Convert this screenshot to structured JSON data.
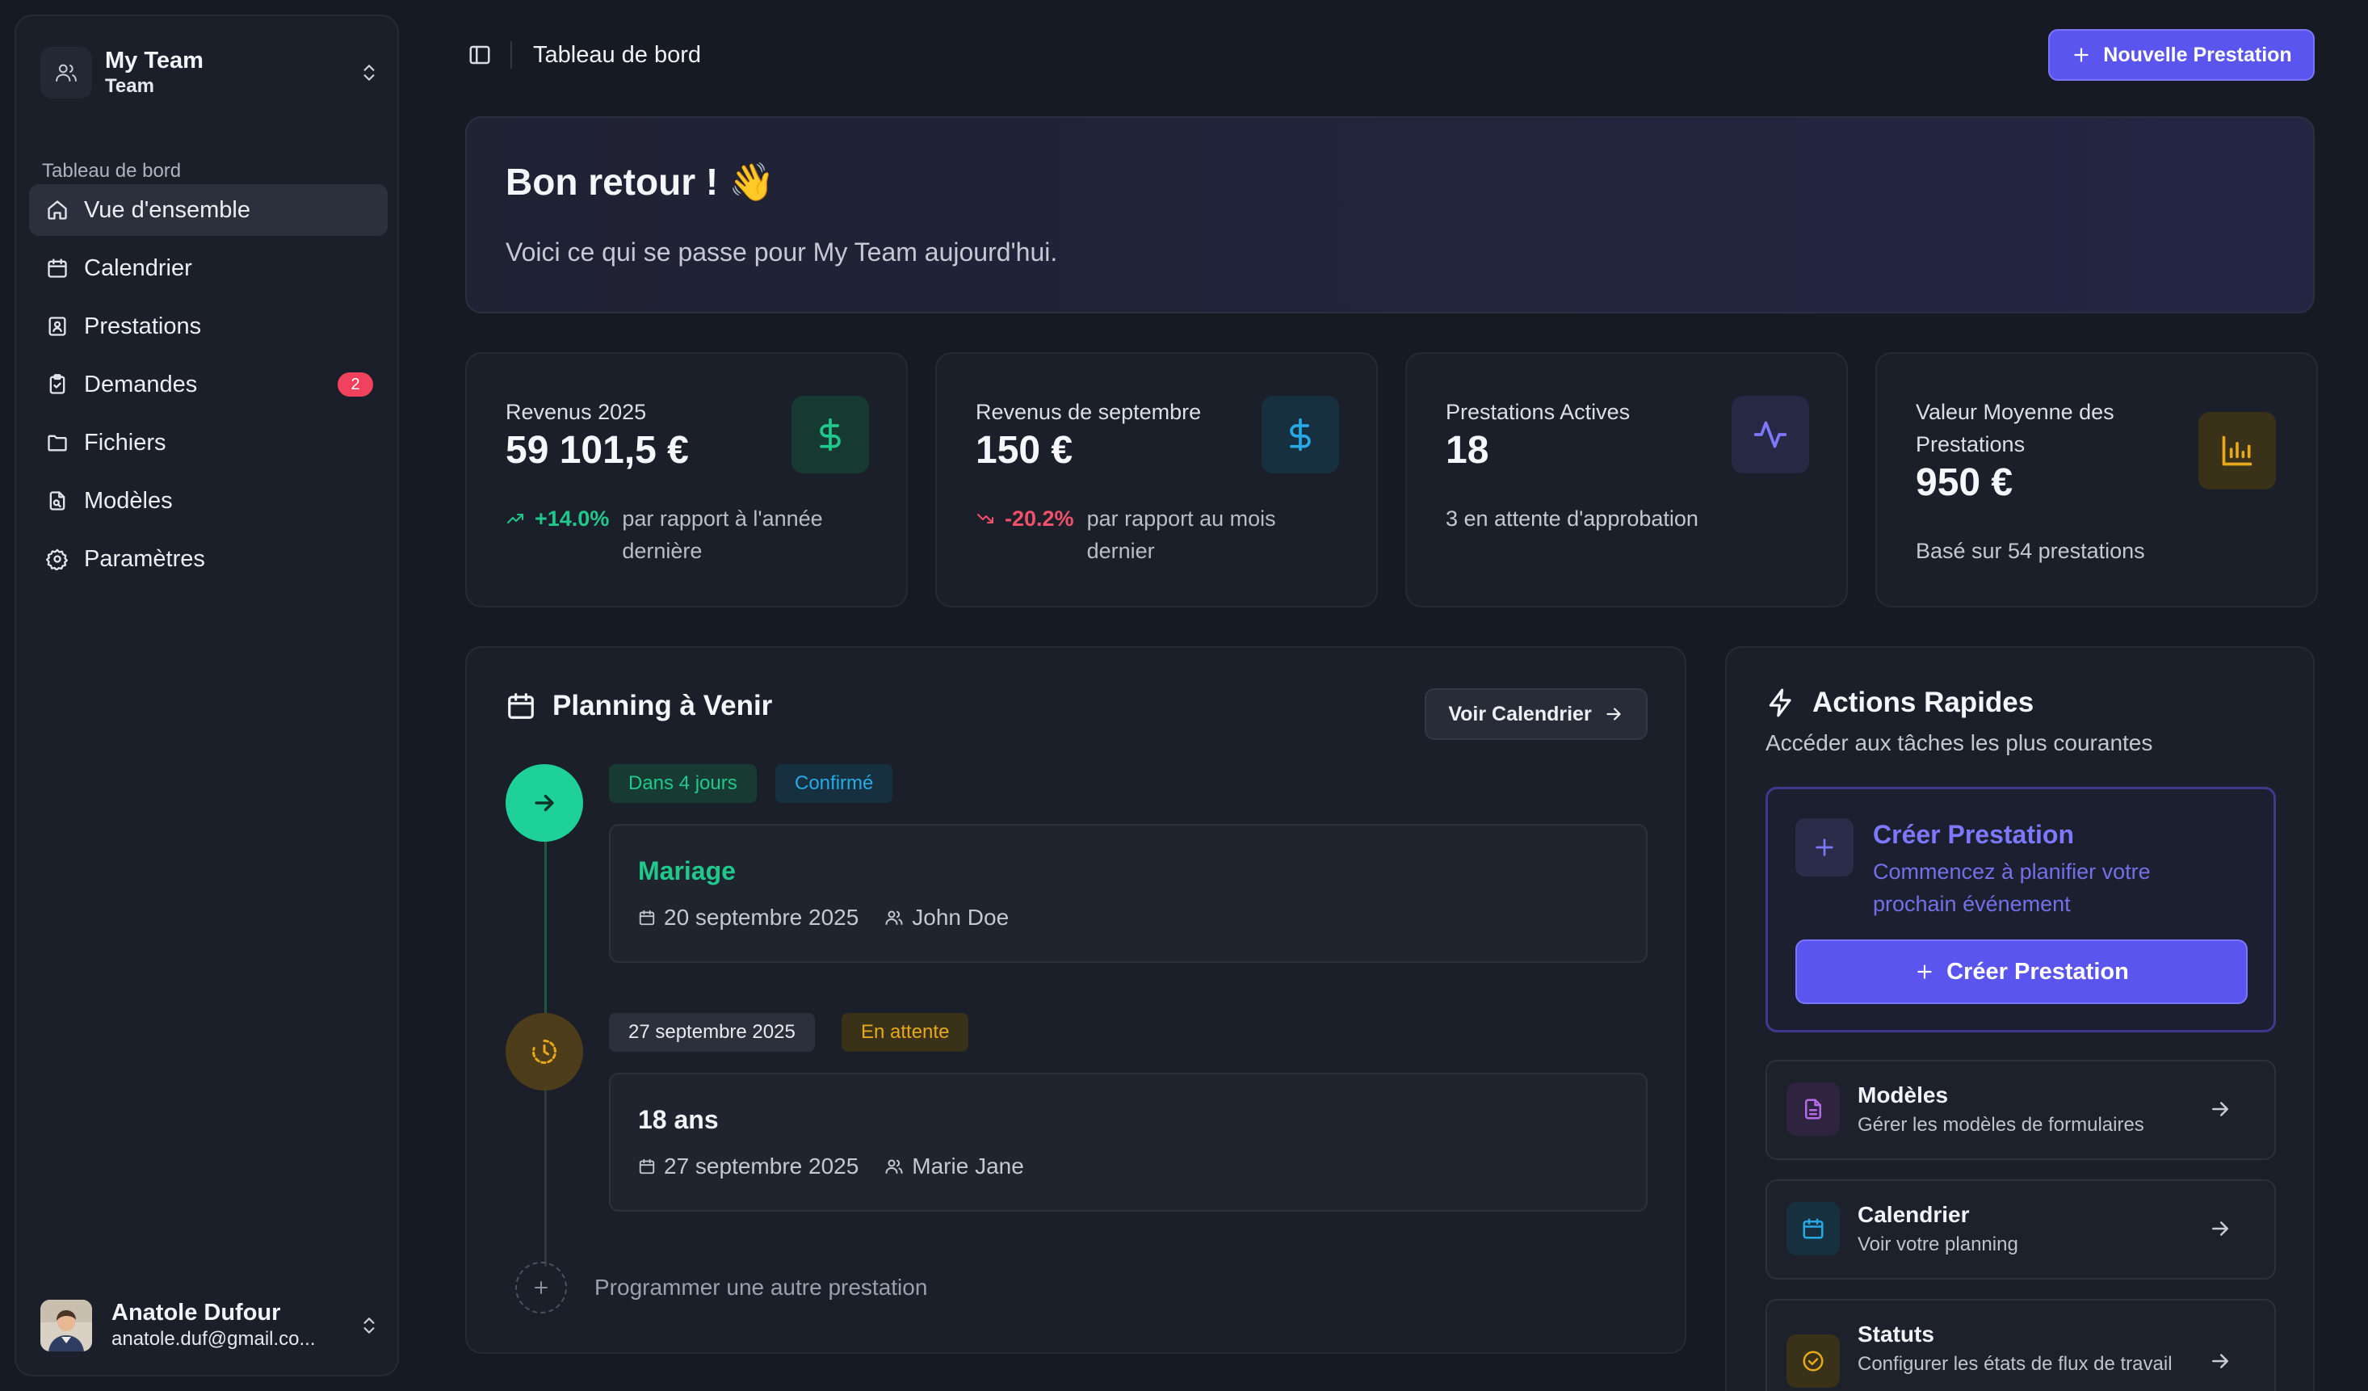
{
  "sidebar": {
    "team_name": "My Team",
    "team_sub": "Team",
    "section_label": "Tableau de bord",
    "items": [
      {
        "label": "Vue d'ensemble",
        "icon": "home-icon",
        "active": true
      },
      {
        "label": "Calendrier",
        "icon": "calendar-icon"
      },
      {
        "label": "Prestations",
        "icon": "contact-book-icon"
      },
      {
        "label": "Demandes",
        "icon": "clipboard-icon",
        "badge": "2"
      },
      {
        "label": "Fichiers",
        "icon": "folder-icon"
      },
      {
        "label": "Modèles",
        "icon": "file-template-icon"
      },
      {
        "label": "Paramètres",
        "icon": "gear-icon"
      }
    ],
    "user": {
      "name": "Anatole Dufour",
      "email": "anatole.duf@gmail.co..."
    }
  },
  "header": {
    "title": "Tableau de bord",
    "new_button": "Nouvelle Prestation"
  },
  "welcome": {
    "title": "Bon retour ! 👋",
    "subtitle": "Voici ce qui se passe pour My Team aujourd'hui."
  },
  "stats": [
    {
      "label": "Revenus 2025",
      "value": "59 101,5 €",
      "trend": "+14.0%",
      "trend_dir": "up",
      "desc": "par rapport à l'année dernière",
      "icon": "dollar-icon",
      "color": "#20c98b"
    },
    {
      "label": "Revenus de septembre",
      "value": "150 €",
      "trend": "-20.2%",
      "trend_dir": "down",
      "desc": "par rapport au mois dernier",
      "icon": "dollar-icon",
      "color": "#27a9e6"
    },
    {
      "label": "Prestations Actives",
      "value": "18",
      "desc": "3 en attente d'approbation",
      "icon": "activity-icon",
      "color": "#7d78ff"
    },
    {
      "label": "Valeur Moyenne des Prestations",
      "value": "950 €",
      "desc": "Basé sur 54 prestations",
      "icon": "bar-chart-icon",
      "color": "#e7a81b"
    }
  ],
  "planning": {
    "title": "Planning à Venir",
    "calendar_button": "Voir Calendrier",
    "events": [
      {
        "tag_when": "Dans 4 jours",
        "tag_status": "Confirmé",
        "title": "Mariage",
        "date": "20 septembre 2025",
        "person": "John Doe"
      },
      {
        "tag_when": "27 septembre 2025",
        "tag_status": "En attente",
        "title": "18 ans",
        "date": "27 septembre 2025",
        "person": "Marie Jane"
      }
    ],
    "add_more": "Programmer une autre prestation"
  },
  "quick_actions": {
    "title": "Actions Rapides",
    "subtitle": "Accéder aux tâches les plus courantes",
    "create": {
      "title": "Créer Prestation",
      "desc": "Commencez à planifier votre prochain événement",
      "button": "Créer Prestation"
    },
    "items": [
      {
        "title": "Modèles",
        "desc": "Gérer les modèles de formulaires",
        "icon": "file-text-icon",
        "color": "#b56be8"
      },
      {
        "title": "Calendrier",
        "desc": "Voir votre planning",
        "icon": "calendar-icon",
        "color": "#27a9e6"
      },
      {
        "title": "Statuts",
        "desc": "Configurer les états de flux de travail",
        "icon": "check-circle-icon",
        "color": "#e7a81b"
      }
    ]
  }
}
